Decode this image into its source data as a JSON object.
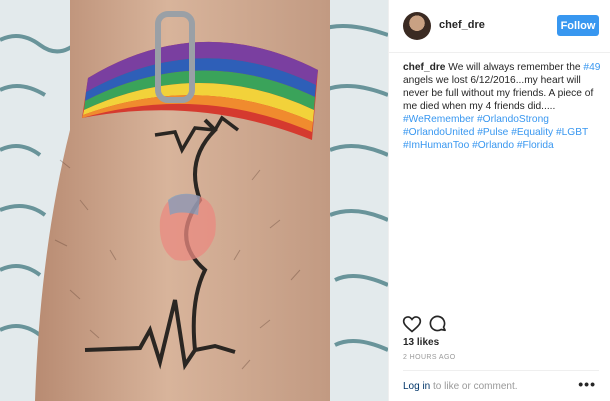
{
  "post": {
    "username": "chef_dre",
    "follow_label": "Follow",
    "caption_user": "chef_dre",
    "caption_parts": [
      {
        "text": " We will always remember the ",
        "kind": "text"
      },
      {
        "text": "#49",
        "kind": "tag"
      },
      {
        "text": " angels we lost 6/12/2016...my heart will never be full without my friends. A piece of me died when my 4 friends did..... ",
        "kind": "text"
      },
      {
        "text": "#WeRemember",
        "kind": "tag"
      },
      {
        "text": " ",
        "kind": "text"
      },
      {
        "text": "#OrlandoStrong",
        "kind": "tag"
      },
      {
        "text": " ",
        "kind": "text"
      },
      {
        "text": "#OrlandoUnited",
        "kind": "tag"
      },
      {
        "text": " ",
        "kind": "text"
      },
      {
        "text": "#Pulse",
        "kind": "tag"
      },
      {
        "text": " ",
        "kind": "text"
      },
      {
        "text": "#Equality",
        "kind": "tag"
      },
      {
        "text": " ",
        "kind": "text"
      },
      {
        "text": "#LGBT",
        "kind": "tag"
      },
      {
        "text": " ",
        "kind": "text"
      },
      {
        "text": "#ImHumanToo",
        "kind": "tag"
      },
      {
        "text": " ",
        "kind": "text"
      },
      {
        "text": "#Orlando",
        "kind": "tag"
      },
      {
        "text": " ",
        "kind": "text"
      },
      {
        "text": "#Florida",
        "kind": "tag"
      }
    ],
    "likes": "13 likes",
    "time": "2 HOURS AGO",
    "login_link": "Log in",
    "login_rest": " to like or comment.",
    "more_label": "•••",
    "icons": {
      "like": "heart-icon",
      "comment": "comment-icon",
      "more": "more-options-icon"
    },
    "colors": {
      "accent": "#3897f0",
      "tag": "#003569",
      "meta": "#999999"
    }
  }
}
